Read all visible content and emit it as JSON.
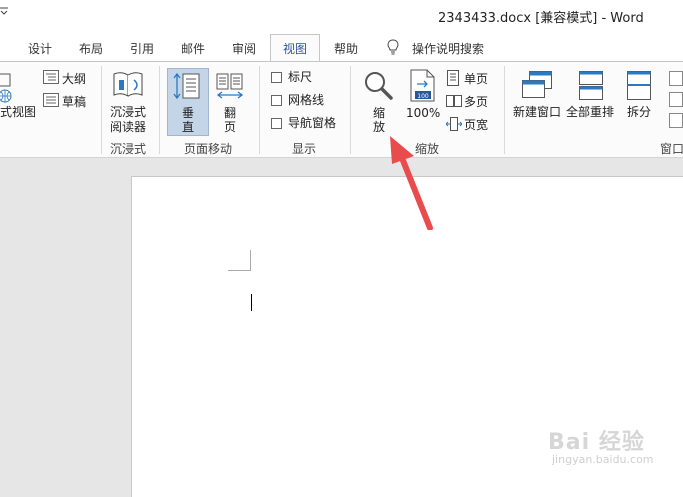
{
  "window": {
    "title": "2343433.docx [兼容模式]  -  Word",
    "qat_arrow": "⇨"
  },
  "tabs": [
    "设计",
    "布局",
    "引用",
    "邮件",
    "审阅",
    "视图",
    "帮助"
  ],
  "tell_me": {
    "icon": "lightbulb-icon",
    "label": "操作说明搜索"
  },
  "ribbon": {
    "views": {
      "web_label": "式视图",
      "outline_label": "大纲",
      "draft_label": "草稿"
    },
    "immersive": {
      "reader_label_1": "沉浸式",
      "reader_label_2": "阅读器",
      "group_label": "沉浸式"
    },
    "page_move": {
      "vertical_1": "垂",
      "vertical_2": "直",
      "flip_1": "翻",
      "flip_2": "页",
      "group_label": "页面移动"
    },
    "show": {
      "ruler": "标尺",
      "gridlines": "网格线",
      "nav_pane": "导航窗格",
      "group_label": "显示"
    },
    "zoom": {
      "zoom_1": "缩",
      "zoom_2": "放",
      "hundred": "100%",
      "one_page": "单页",
      "multi_page": "多页",
      "page_width": "页宽",
      "group_label": "缩放"
    },
    "window": {
      "new_window": "新建窗口",
      "arrange_all": "全部重排",
      "split": "拆分",
      "group_label": "窗口"
    }
  },
  "watermark": {
    "logo": "Bai 经验",
    "url": "jingyan.baidu.com"
  },
  "colors": {
    "accent": "#2b579a",
    "arrow": "#e84c4c",
    "selected": "#c5d5e8"
  }
}
